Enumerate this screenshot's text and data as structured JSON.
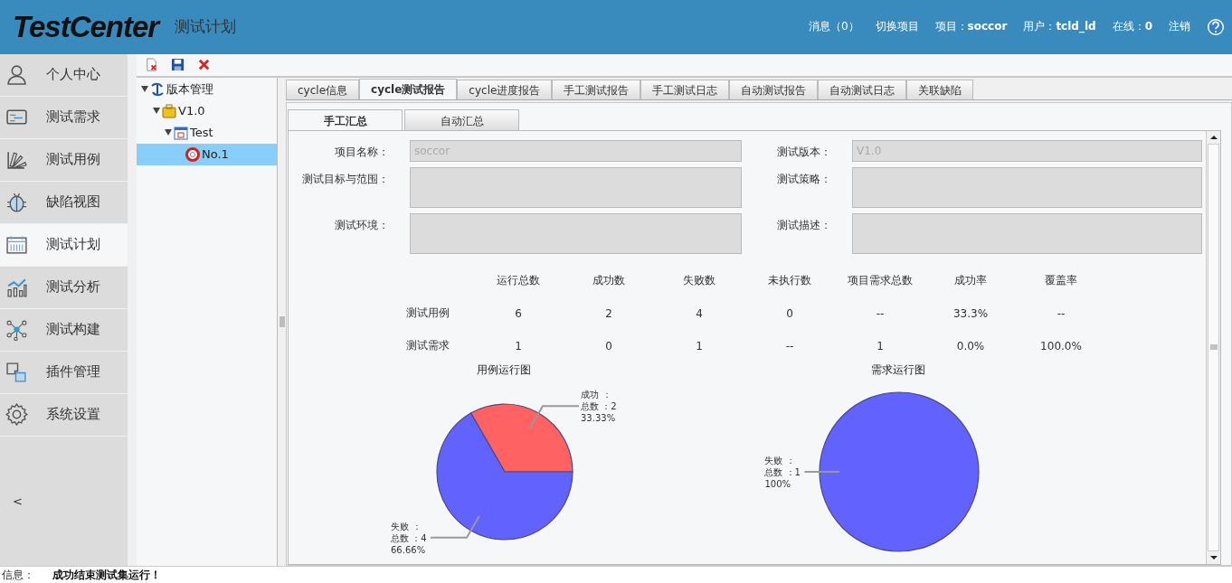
{
  "header": {
    "logo": "TestCenter",
    "page_title": "测试计划",
    "links": [
      {
        "kind": "link",
        "label": "消息（0）"
      },
      {
        "kind": "link",
        "label": "切换项目"
      },
      {
        "kind": "info",
        "label": "项目：",
        "value": "soccor"
      },
      {
        "kind": "info",
        "label": "用户：",
        "value": "tcld_ld"
      },
      {
        "kind": "info",
        "label": "在线：",
        "value": "0"
      },
      {
        "kind": "link",
        "label": "注销"
      }
    ]
  },
  "sidebar": {
    "items": [
      {
        "label": "个人中心",
        "selected": false
      },
      {
        "label": "测试需求",
        "selected": false
      },
      {
        "label": "测试用例",
        "selected": false
      },
      {
        "label": "缺陷视图",
        "selected": false
      },
      {
        "label": "测试计划",
        "selected": true
      },
      {
        "label": "测试分析",
        "selected": false
      },
      {
        "label": "测试构建",
        "selected": false
      },
      {
        "label": "插件管理",
        "selected": false
      },
      {
        "label": "系统设置",
        "selected": false
      }
    ],
    "collapse": "<"
  },
  "tree": [
    {
      "label": "版本管理",
      "kind": "root",
      "expanded": true,
      "selected": false,
      "children": [
        {
          "label": "V1.0",
          "kind": "version",
          "expanded": true,
          "selected": false,
          "children": [
            {
              "label": "Test",
              "kind": "suite",
              "expanded": true,
              "selected": false,
              "children": [
                {
                  "label": "No.1",
                  "kind": "cycle",
                  "selected": true
                }
              ]
            }
          ]
        }
      ]
    }
  ],
  "tabs": [
    {
      "label": "cycle信息",
      "selected": false
    },
    {
      "label": "cycle测试报告",
      "selected": true
    },
    {
      "label": "cycle进度报告",
      "selected": false
    },
    {
      "label": "手工测试报告",
      "selected": false
    },
    {
      "label": "手工测试日志",
      "selected": false
    },
    {
      "label": "自动测试报告",
      "selected": false
    },
    {
      "label": "自动测试日志",
      "selected": false
    },
    {
      "label": "关联缺陷",
      "selected": false
    }
  ],
  "subtabs": [
    {
      "label": "手工汇总",
      "selected": true
    },
    {
      "label": "自动汇总",
      "selected": false
    }
  ],
  "form": [
    {
      "label": "项目名称：",
      "kind": "line",
      "value": "soccor",
      "disabled": true
    },
    {
      "label": "测试版本：",
      "kind": "line",
      "value": "V1.0",
      "disabled": true
    },
    {
      "label": "测试目标与范围：",
      "kind": "area",
      "disabled": true
    },
    {
      "label": "测试策略：",
      "kind": "area",
      "disabled": true
    },
    {
      "label": "测试环境：",
      "kind": "area",
      "disabled": true
    },
    {
      "label": "测试描述：",
      "kind": "area",
      "disabled": true
    }
  ],
  "stats": {
    "columns": [
      "运行总数",
      "成功数",
      "失败数",
      "未执行数",
      "项目需求总数",
      "成功率",
      "覆盖率"
    ],
    "rows": [
      {
        "label": "测试用例",
        "cells": [
          "6",
          "2",
          "4",
          "0",
          "--",
          "33.3%",
          "--"
        ]
      },
      {
        "label": "测试需求",
        "cells": [
          "1",
          "0",
          "1",
          "--",
          "1",
          "0.0%",
          "100.0%"
        ]
      }
    ]
  },
  "charts": [
    {
      "label_separator": "：",
      "chart_data": {
        "type": "pie",
        "title": "用例运行图",
        "categories": [
          "成功",
          "失败"
        ],
        "values": [
          33.33,
          66.66
        ],
        "colors": [
          "#ff6262",
          "#6262ff"
        ],
        "annotations": [
          "总数 ：2",
          "总数 ：4"
        ],
        "value_labels": [
          "33.33%",
          "66.66%"
        ]
      }
    },
    {
      "label_separator": "：",
      "chart_data": {
        "type": "pie",
        "title": "需求运行图",
        "categories": [
          "失败"
        ],
        "values": [
          100
        ],
        "colors": [
          "#6262ff"
        ],
        "annotations": [
          "总数 ：1"
        ],
        "value_labels": [
          "100%"
        ]
      }
    }
  ],
  "status_bar": {
    "label": "信息：",
    "message": "成功结束测试集运行！"
  }
}
